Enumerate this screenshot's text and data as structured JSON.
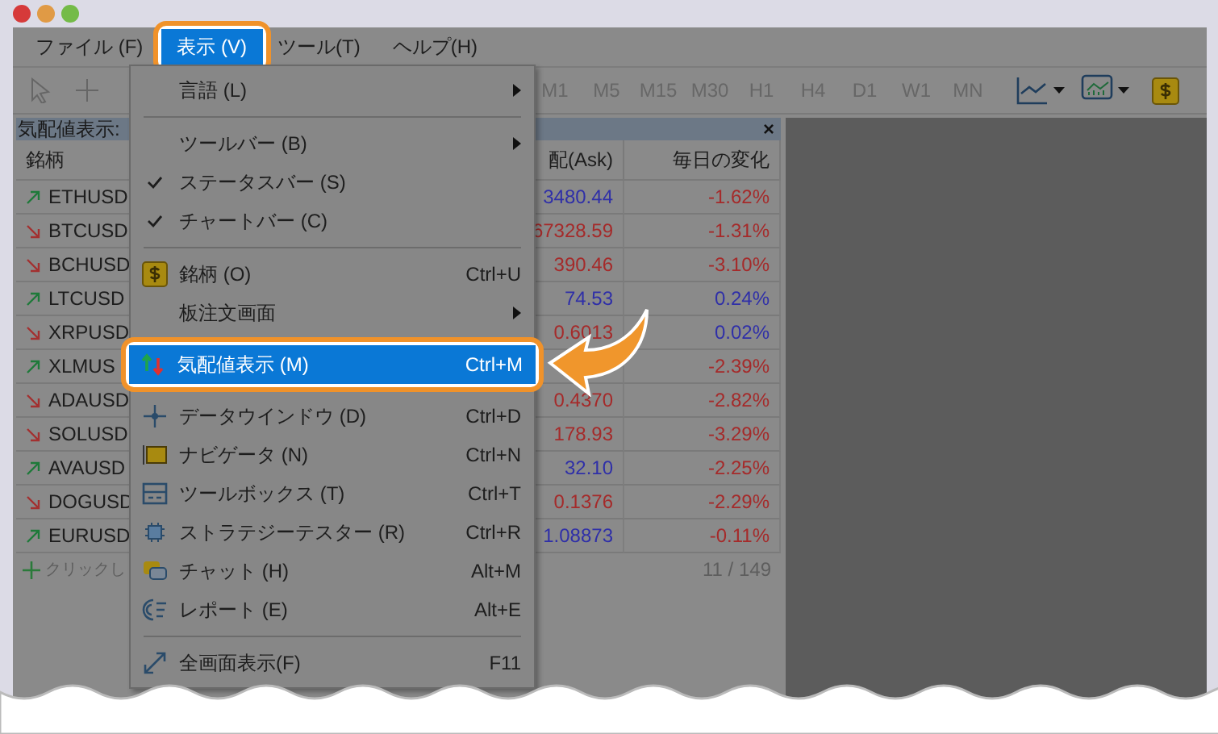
{
  "menu_bar": [
    {
      "label": "ファイル (F)",
      "selected": false
    },
    {
      "label": "表示 (V)",
      "selected": true
    },
    {
      "label": "ツール(T)",
      "selected": false
    },
    {
      "label": "ヘルプ(H)",
      "selected": false
    }
  ],
  "toolbar": {
    "timeframes": [
      "M1",
      "M5",
      "M15",
      "M30",
      "H1",
      "H4",
      "D1",
      "W1",
      "MN"
    ]
  },
  "view_menu": {
    "items": [
      {
        "kind": "item",
        "label": "言語 (L)",
        "submenu": true,
        "checked": false,
        "selected": false
      },
      {
        "kind": "separator"
      },
      {
        "kind": "item",
        "label": "ツールバー (B)",
        "submenu": true,
        "checked": false,
        "selected": false
      },
      {
        "kind": "item",
        "label": "ステータスバー (S)",
        "submenu": false,
        "checked": true,
        "selected": false
      },
      {
        "kind": "item",
        "label": "チャートバー (C)",
        "submenu": false,
        "checked": true,
        "selected": false
      },
      {
        "kind": "separator"
      },
      {
        "kind": "item",
        "label": "銘柄 (O)",
        "shortcut": "Ctrl+U",
        "submenu": false,
        "checked": false,
        "selected": false
      },
      {
        "kind": "item",
        "label": "板注文画面",
        "submenu": true,
        "checked": false,
        "selected": false
      },
      {
        "kind": "item",
        "label": "気配値表示 (M)",
        "shortcut": "Ctrl+M",
        "submenu": false,
        "checked": false,
        "selected": true
      },
      {
        "kind": "item",
        "label": "データウインドウ (D)",
        "shortcut": "Ctrl+D",
        "submenu": false,
        "checked": false,
        "selected": false
      },
      {
        "kind": "item",
        "label": "ナビゲータ (N)",
        "shortcut": "Ctrl+N",
        "submenu": false,
        "checked": false,
        "selected": false
      },
      {
        "kind": "item",
        "label": "ツールボックス (T)",
        "shortcut": "Ctrl+T",
        "submenu": false,
        "checked": false,
        "selected": false
      },
      {
        "kind": "item",
        "label": "ストラテジーテスター (R)",
        "shortcut": "Ctrl+R",
        "submenu": false,
        "checked": false,
        "selected": false
      },
      {
        "kind": "item",
        "label": "チャット (H)",
        "shortcut": "Alt+M",
        "submenu": false,
        "checked": false,
        "selected": false
      },
      {
        "kind": "item",
        "label": "レポート (E)",
        "shortcut": "Alt+E",
        "submenu": false,
        "checked": false,
        "selected": false
      },
      {
        "kind": "separator"
      },
      {
        "kind": "item",
        "label": "全画面表示(F)",
        "shortcut": "F11",
        "submenu": false,
        "checked": false,
        "selected": false
      }
    ]
  },
  "market_watch": {
    "title": "気配値表示:",
    "close": "×",
    "columns": [
      "銘柄",
      "配(Ask)",
      "毎日の変化"
    ],
    "rows": [
      {
        "symbol": "ETHUSD",
        "rising": true,
        "ask": "3480.44",
        "change": "-1.62%",
        "change_rising": false
      },
      {
        "symbol": "BTCUSD",
        "rising": false,
        "ask": "67328.59",
        "change": "-1.31%",
        "change_rising": false
      },
      {
        "symbol": "BCHUSD",
        "rising": false,
        "ask": "390.46",
        "change": "-3.10%",
        "change_rising": false
      },
      {
        "symbol": "LTCUSD",
        "rising": true,
        "ask": "74.53",
        "change": "0.24%",
        "change_rising": true
      },
      {
        "symbol": "XRPUSD",
        "rising": false,
        "ask": "0.6013",
        "change": "0.02%",
        "change_rising": true
      },
      {
        "symbol": "XLMUS",
        "rising": true,
        "change": "-2.39%",
        "change_rising": false
      },
      {
        "symbol": "ADAUSD",
        "rising": false,
        "ask": "0.4370",
        "change": "-2.82%",
        "change_rising": false
      },
      {
        "symbol": "SOLUSD",
        "rising": false,
        "ask": "178.93",
        "change": "-3.29%",
        "change_rising": false
      },
      {
        "symbol": "AVAUSD",
        "rising": true,
        "ask": "32.10",
        "change": "-2.25%",
        "change_rising": false
      },
      {
        "symbol": "DOGUSD",
        "rising": false,
        "ask": "0.1376",
        "change": "-2.29%",
        "change_rising": false
      },
      {
        "symbol": "EURUSD",
        "rising": true,
        "ask": "1.08873",
        "change": "-0.11%",
        "change_rising": false
      }
    ],
    "add_hint": "クリックし",
    "count": "11 / 149"
  }
}
